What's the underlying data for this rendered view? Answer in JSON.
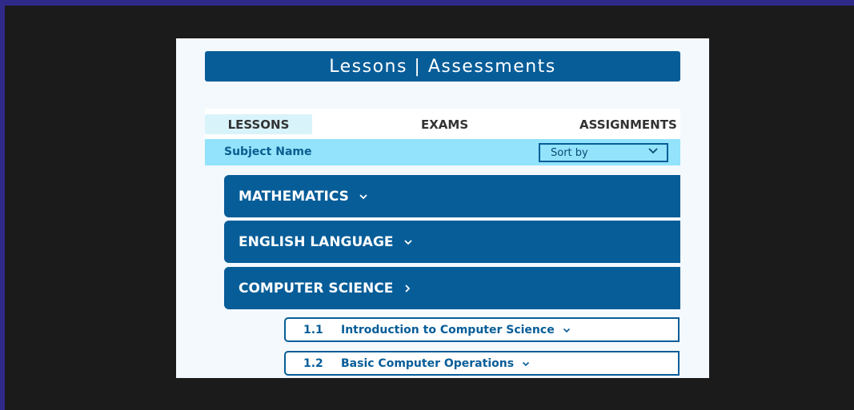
{
  "header": {
    "title": "Lessons | Assessments"
  },
  "tabs": [
    {
      "label": "LESSONS",
      "active": true
    },
    {
      "label": "EXAMS",
      "active": false
    },
    {
      "label": "ASSIGNMENTS",
      "active": false
    }
  ],
  "filter": {
    "subject_label": "Subject Name",
    "sort_value": "Sort by"
  },
  "subjects": [
    {
      "label": "MATHEMATICS",
      "state": "collapsed-down"
    },
    {
      "label": "ENGLISH LANGUAGE",
      "state": "collapsed-down"
    },
    {
      "label": "COMPUTER SCIENCE",
      "state": "expanded-right"
    }
  ],
  "lessons": [
    {
      "number": "1.1",
      "title": "Introduction to Computer Science"
    },
    {
      "number": "1.2",
      "title": "Basic Computer Operations"
    }
  ],
  "colors": {
    "primary": "#075d98",
    "accent_light": "#92e3fb",
    "active_tab": "#d9f3fb",
    "panel_bg": "#f4f9fd"
  }
}
